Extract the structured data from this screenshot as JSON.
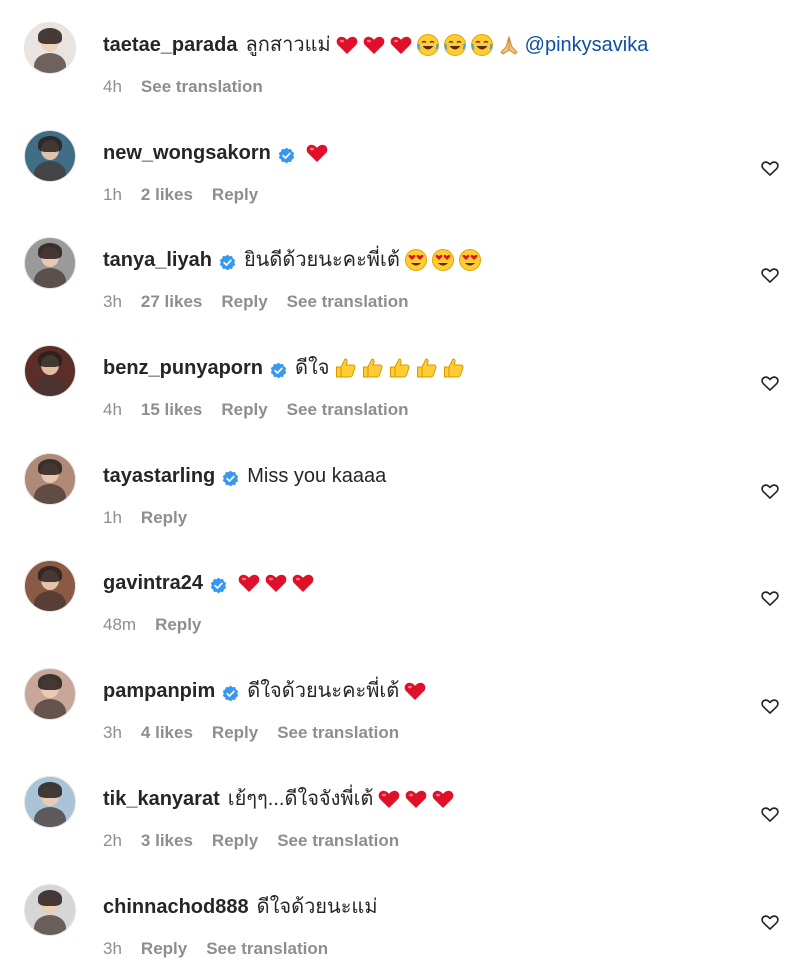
{
  "comments": [
    {
      "username": "taetae_parada",
      "verified": false,
      "text": "ลูกสาวแม่",
      "emojis": [
        "red-heart",
        "red-heart",
        "red-heart",
        "joy",
        "joy",
        "joy",
        "folded-hands"
      ],
      "mention": "@pinkysavika",
      "time": "4h",
      "likes": "",
      "reply": "",
      "see_translation": "See translation",
      "has_like_button": false,
      "avatar_color": "#e9e4e0"
    },
    {
      "username": "new_wongsakorn",
      "verified": true,
      "text": "",
      "emojis": [
        "red-heart"
      ],
      "mention": "",
      "time": "1h",
      "likes": "2 likes",
      "reply": "Reply",
      "see_translation": "",
      "has_like_button": true,
      "avatar_color": "#3f6e86"
    },
    {
      "username": "tanya_liyah",
      "verified": true,
      "text": "ยินดีด้วยนะคะพี่เต้",
      "emojis": [
        "heart-eyes",
        "heart-eyes",
        "heart-eyes"
      ],
      "mention": "",
      "time": "3h",
      "likes": "27 likes",
      "reply": "Reply",
      "see_translation": "See translation",
      "has_like_button": true,
      "avatar_color": "#9a9a9a"
    },
    {
      "username": "benz_punyaporn",
      "verified": true,
      "text": "ดีใจ",
      "emojis": [
        "thumbs-up",
        "thumbs-up",
        "thumbs-up",
        "thumbs-up",
        "thumbs-up"
      ],
      "mention": "",
      "time": "4h",
      "likes": "15 likes",
      "reply": "Reply",
      "see_translation": "See translation",
      "has_like_button": true,
      "avatar_color": "#5b2e2a"
    },
    {
      "username": "tayastarling",
      "verified": true,
      "text": "Miss you kaaaa",
      "emojis": [],
      "mention": "",
      "time": "1h",
      "likes": "",
      "reply": "Reply",
      "see_translation": "",
      "has_like_button": true,
      "avatar_color": "#b08a78"
    },
    {
      "username": "gavintra24",
      "verified": true,
      "text": "",
      "emojis": [
        "red-heart",
        "red-heart",
        "red-heart"
      ],
      "mention": "",
      "time": "48m",
      "likes": "",
      "reply": "Reply",
      "see_translation": "",
      "has_like_button": true,
      "avatar_color": "#8a5a44"
    },
    {
      "username": "pampanpim",
      "verified": true,
      "text": "ดีใจด้วยนะคะพี่เต้",
      "emojis": [
        "red-heart"
      ],
      "mention": "",
      "time": "3h",
      "likes": "4 likes",
      "reply": "Reply",
      "see_translation": "See translation",
      "has_like_button": true,
      "avatar_color": "#c7a79a"
    },
    {
      "username": "tik_kanyarat",
      "verified": false,
      "text": "เย้ๆๆ...ดีใจจังพี่เต้",
      "emojis": [
        "red-heart",
        "red-heart",
        "red-heart"
      ],
      "mention": "",
      "time": "2h",
      "likes": "3 likes",
      "reply": "Reply",
      "see_translation": "See translation",
      "has_like_button": true,
      "avatar_color": "#a9c4d6"
    },
    {
      "username": "chinnachod888",
      "verified": false,
      "text": "ดีใจด้วยนะแม่",
      "emojis": [],
      "mention": "",
      "time": "3h",
      "likes": "",
      "reply": "Reply",
      "see_translation": "See translation",
      "has_like_button": true,
      "avatar_color": "#d6d6d6"
    }
  ],
  "colors": {
    "text_primary": "#262626",
    "text_secondary": "#8e8e8e",
    "verified_blue": "#3897f0",
    "heart_red": "#e0102a",
    "mention_blue": "#0a4fa8"
  }
}
